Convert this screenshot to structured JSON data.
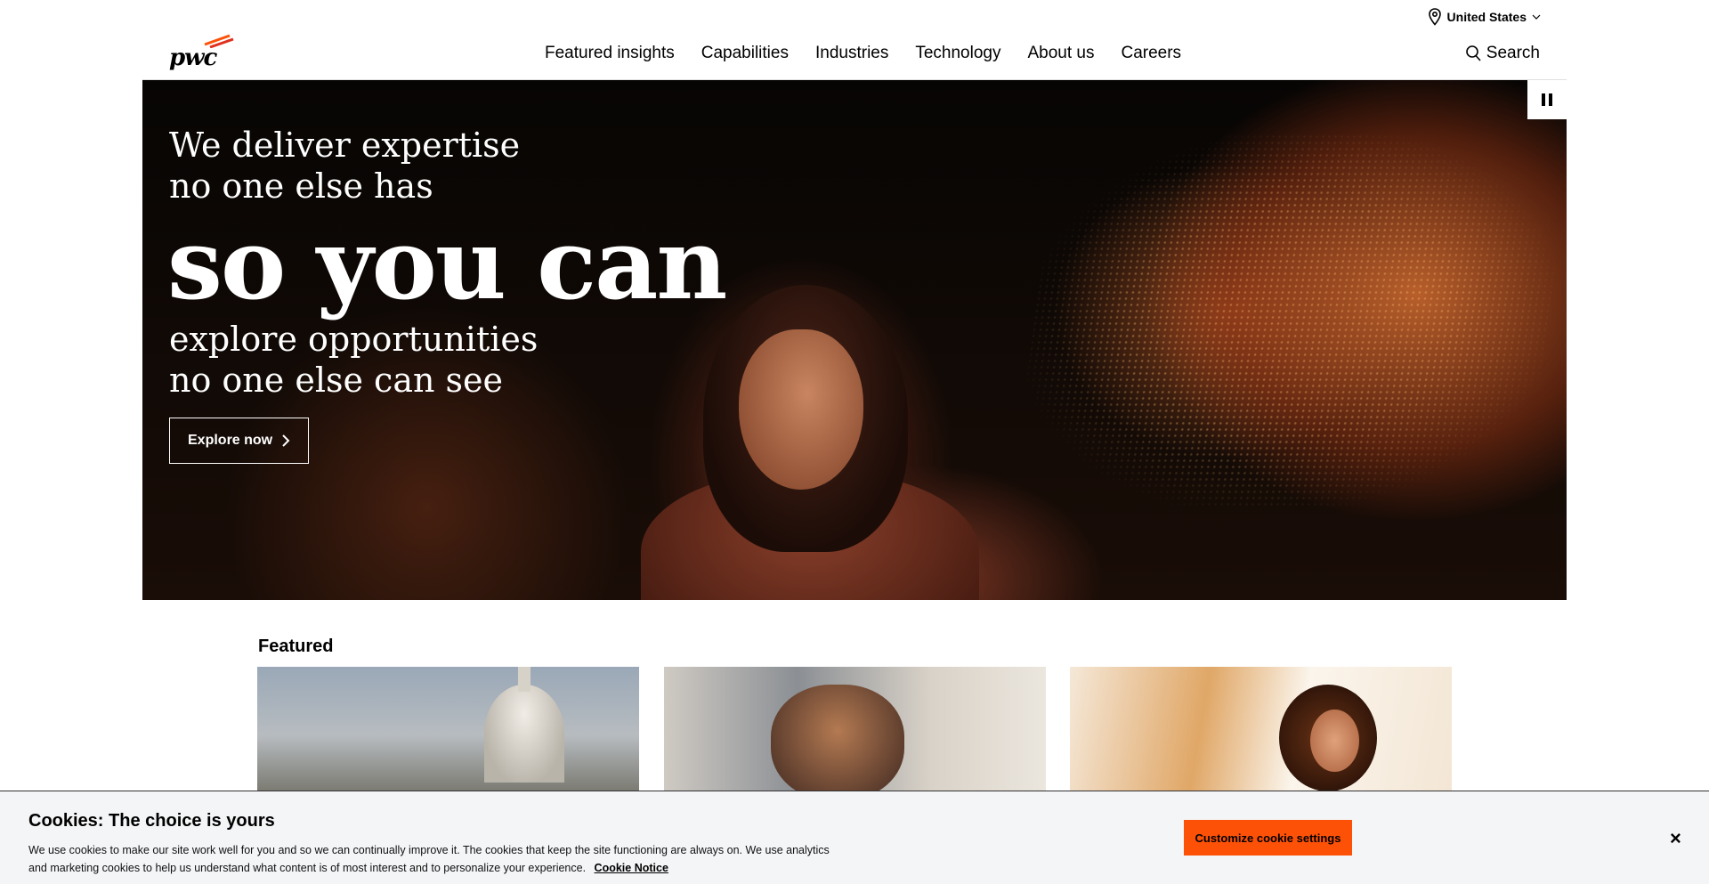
{
  "utility": {
    "location_label": "United States",
    "location_icon": "location-pin-icon"
  },
  "header": {
    "logo_text": "pwc",
    "nav": [
      "Featured insights",
      "Capabilities",
      "Industries",
      "Technology",
      "About us",
      "Careers"
    ],
    "search_label": "Search"
  },
  "hero": {
    "line1": "We deliver expertise",
    "line2": "no one else has",
    "big": "so you can",
    "line3": "explore opportunities",
    "line4": "no one else can see",
    "cta": "Explore now"
  },
  "featured": {
    "title": "Featured"
  },
  "cookie": {
    "title": "Cookies: The choice is yours",
    "text": "We use cookies to make our site work well for you and so we can continually improve it. The cookies that keep the site functioning are always on. We use analytics and marketing cookies to help us understand what content is of most interest and to personalize your experience.",
    "link": "Cookie Notice",
    "button": "Customize cookie settings",
    "close": "×"
  },
  "colors": {
    "brand_orange": "#fd5108",
    "brand_red": "#e0301e"
  }
}
